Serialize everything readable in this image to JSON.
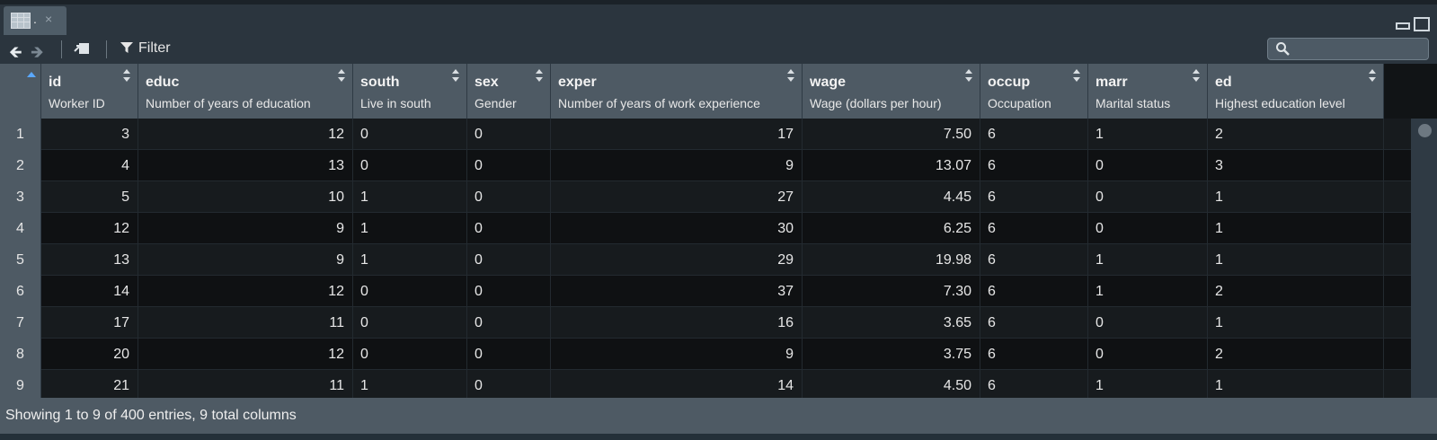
{
  "tab": {
    "title": ".",
    "close": "×"
  },
  "toolbar": {
    "filter_label": "Filter",
    "search_placeholder": ""
  },
  "columns": [
    {
      "name": "id",
      "label": "Worker ID",
      "align": "right"
    },
    {
      "name": "educ",
      "label": "Number of years of education",
      "align": "right"
    },
    {
      "name": "south",
      "label": "Live in south",
      "align": "left"
    },
    {
      "name": "sex",
      "label": "Gender",
      "align": "left"
    },
    {
      "name": "exper",
      "label": "Number of years of work experience",
      "align": "right"
    },
    {
      "name": "wage",
      "label": "Wage (dollars per hour)",
      "align": "right"
    },
    {
      "name": "occup",
      "label": "Occupation",
      "align": "left"
    },
    {
      "name": "marr",
      "label": "Marital status",
      "align": "left"
    },
    {
      "name": "ed",
      "label": "Highest education level",
      "align": "left"
    }
  ],
  "rows": [
    {
      "n": "1",
      "cells": [
        "3",
        "12",
        "0",
        "0",
        "17",
        "7.50",
        "6",
        "1",
        "2"
      ]
    },
    {
      "n": "2",
      "cells": [
        "4",
        "13",
        "0",
        "0",
        "9",
        "13.07",
        "6",
        "0",
        "3"
      ]
    },
    {
      "n": "3",
      "cells": [
        "5",
        "10",
        "1",
        "0",
        "27",
        "4.45",
        "6",
        "0",
        "1"
      ]
    },
    {
      "n": "4",
      "cells": [
        "12",
        "9",
        "1",
        "0",
        "30",
        "6.25",
        "6",
        "0",
        "1"
      ]
    },
    {
      "n": "5",
      "cells": [
        "13",
        "9",
        "1",
        "0",
        "29",
        "19.98",
        "6",
        "1",
        "1"
      ]
    },
    {
      "n": "6",
      "cells": [
        "14",
        "12",
        "0",
        "0",
        "37",
        "7.30",
        "6",
        "1",
        "2"
      ]
    },
    {
      "n": "7",
      "cells": [
        "17",
        "11",
        "0",
        "0",
        "16",
        "3.65",
        "6",
        "0",
        "1"
      ]
    },
    {
      "n": "8",
      "cells": [
        "20",
        "12",
        "0",
        "0",
        "9",
        "3.75",
        "6",
        "0",
        "2"
      ]
    },
    {
      "n": "9",
      "cells": [
        "21",
        "11",
        "1",
        "0",
        "14",
        "4.50",
        "6",
        "1",
        "1"
      ]
    }
  ],
  "footer": {
    "status": "Showing 1 to 9 of 400 entries, 9 total columns"
  },
  "colors": {
    "sort_arrow": "#5aa8ff",
    "header_bg": "#4e5a64",
    "grid_bg": "#111416"
  }
}
